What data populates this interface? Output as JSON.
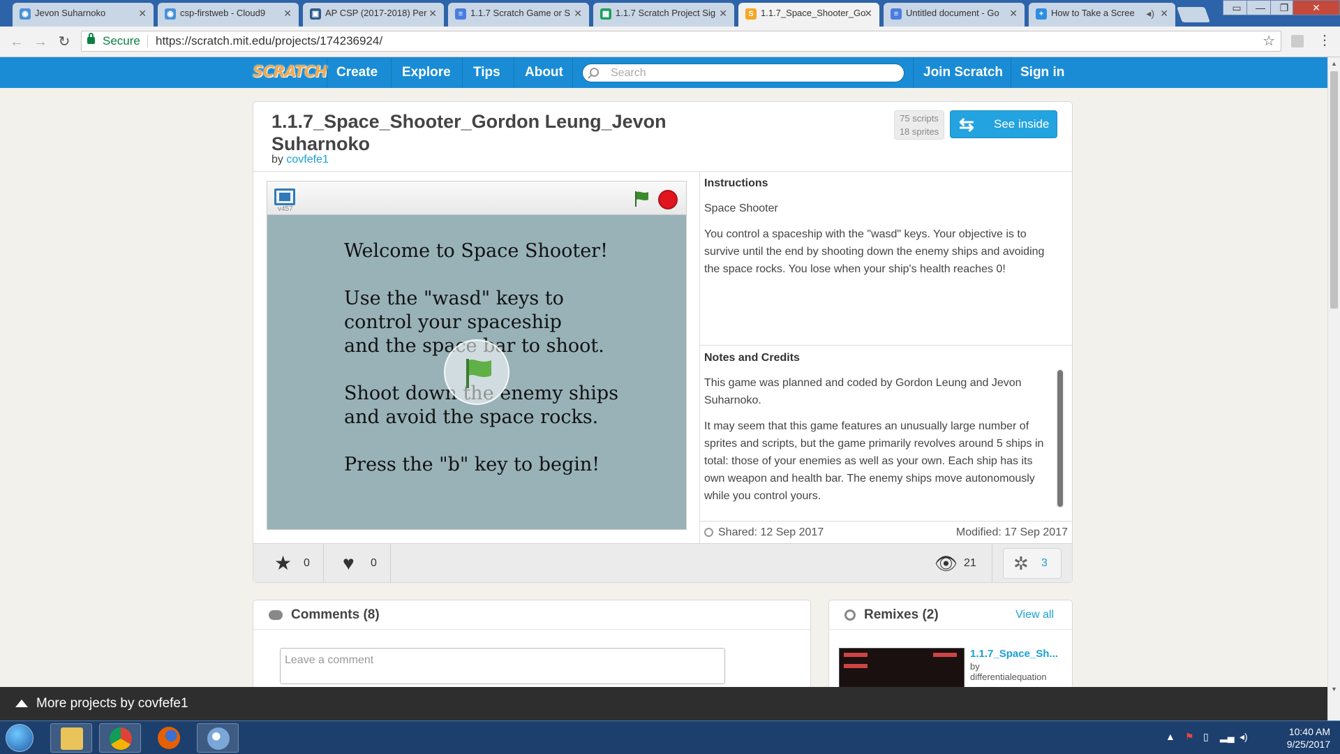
{
  "browser": {
    "tabs": [
      {
        "label": "Jevon Suharnoko",
        "favicon_color": "#4a90d9"
      },
      {
        "label": "csp-firstweb - Cloud9",
        "favicon_color": "#4a90d9"
      },
      {
        "label": "AP CSP (2017-2018) Per",
        "favicon_color": "#2e5c8a"
      },
      {
        "label": "1.1.7 Scratch Game or S",
        "favicon_color": "#4a7de0"
      },
      {
        "label": "1.1.7 Scratch Project Sig",
        "favicon_color": "#1d9e5c"
      },
      {
        "label": "1.1.7_Space_Shooter_Go",
        "favicon_color": "#f5a623"
      },
      {
        "label": "Untitled document - Go",
        "favicon_color": "#4a7de0"
      },
      {
        "label": "How to Take a Scree",
        "favicon_color": "#2d8ee0"
      }
    ],
    "active_tab_index": 5,
    "secure_label": "Secure",
    "url": "https://scratch.mit.edu/projects/174236924/"
  },
  "navbar": {
    "logo": "SCRATCH",
    "links": [
      "Create",
      "Explore",
      "Tips",
      "About"
    ],
    "search_placeholder": "Search",
    "join": "Join Scratch",
    "signin": "Sign in"
  },
  "project": {
    "title": "1.1.7_Space_Shooter_Gordon Leung_Jevon Suharnoko",
    "by_label": "by",
    "author": "covfefe1",
    "scripts": "75 scripts",
    "sprites": "18 sprites",
    "see_inside": "See inside",
    "version": "v457",
    "stage_text": "Welcome to Space Shooter!\n\nUse the \"wasd\" keys to\ncontrol your spaceship\nand the space bar to shoot.\n\nShoot down the enemy ships\nand avoid the space rocks.\n\nPress the \"b\" key to begin!",
    "instructions_title": "Instructions",
    "instructions_p1": "Space Shooter",
    "instructions_p2": "You control a spaceship with the \"wasd\" keys. Your objective is to survive until the end by shooting down the enemy ships and avoiding the space rocks. You lose when your ship's health reaches 0!",
    "notes_title": "Notes and Credits",
    "notes_p1": "This game was planned and coded by Gordon Leung and Jevon Suharnoko.",
    "notes_p2": "It may seem that this game features an unusually large number of sprites and scripts, but the game primarily revolves around 5 ships in total: those of your enemies as well as your own. Each ship has its own weapon and health bar. The enemy ships move autonomously while you control yours.",
    "shared": "Shared: 12 Sep 2017",
    "modified": "Modified: 17 Sep 2017",
    "stars": "0",
    "loves": "0",
    "views": "21",
    "remixes": "3"
  },
  "comments": {
    "title": "Comments (8)",
    "placeholder": "Leave a comment"
  },
  "remixes": {
    "title": "Remixes (2)",
    "view_all": "View all",
    "item_name": "1.1.7_Space_Sh...",
    "item_by": "by",
    "item_author": "differentialequation"
  },
  "more_bar": "More projects by covfefe1",
  "taskbar": {
    "time": "10:40 AM",
    "date": "9/25/2017"
  },
  "colors": {
    "scratch_blue": "#1a8cd6",
    "link_blue": "#1aa0d8",
    "stage_bg": "#98b2b8"
  }
}
